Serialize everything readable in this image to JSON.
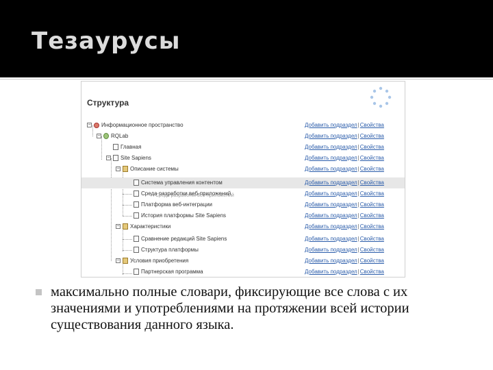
{
  "slide": {
    "title": "Тезаурусы",
    "bullet": "максимально  полные  словари, фиксирующие все слова с их значениями и употреблениями  на протяжении  всей истории существования данного языка."
  },
  "screenshot": {
    "heading": "Структура",
    "link_add": "Добавить подраздел",
    "link_props": "Свойства",
    "separator": "|",
    "tooltip": "Среда разработки веб-приложений",
    "tree": [
      {
        "label": "Информационное пространство",
        "icon": "network-icon"
      },
      {
        "label": "RQLab",
        "icon": "globe-icon"
      },
      {
        "label": "Главная",
        "icon": "page-icon"
      },
      {
        "label": "Site Sapiens",
        "icon": "page-icon"
      },
      {
        "label": "Описание системы",
        "icon": "folder-icon"
      },
      {
        "label": "Система управления контентом",
        "icon": "page-icon"
      },
      {
        "label": "Среда разработки веб-приложений",
        "icon": "page-icon"
      },
      {
        "label": "Платформа веб-интеграции",
        "icon": "page-icon"
      },
      {
        "label": "История платформы Site Sapiens",
        "icon": "page-icon"
      },
      {
        "label": "Характеристики",
        "icon": "folder-icon"
      },
      {
        "label": "Сравнение редакций Site Sapiens",
        "icon": "page-icon"
      },
      {
        "label": "Структура платформы",
        "icon": "page-icon"
      },
      {
        "label": "Условия приобретения",
        "icon": "folder-icon"
      },
      {
        "label": "Партнерская программа",
        "icon": "page-icon"
      }
    ]
  }
}
